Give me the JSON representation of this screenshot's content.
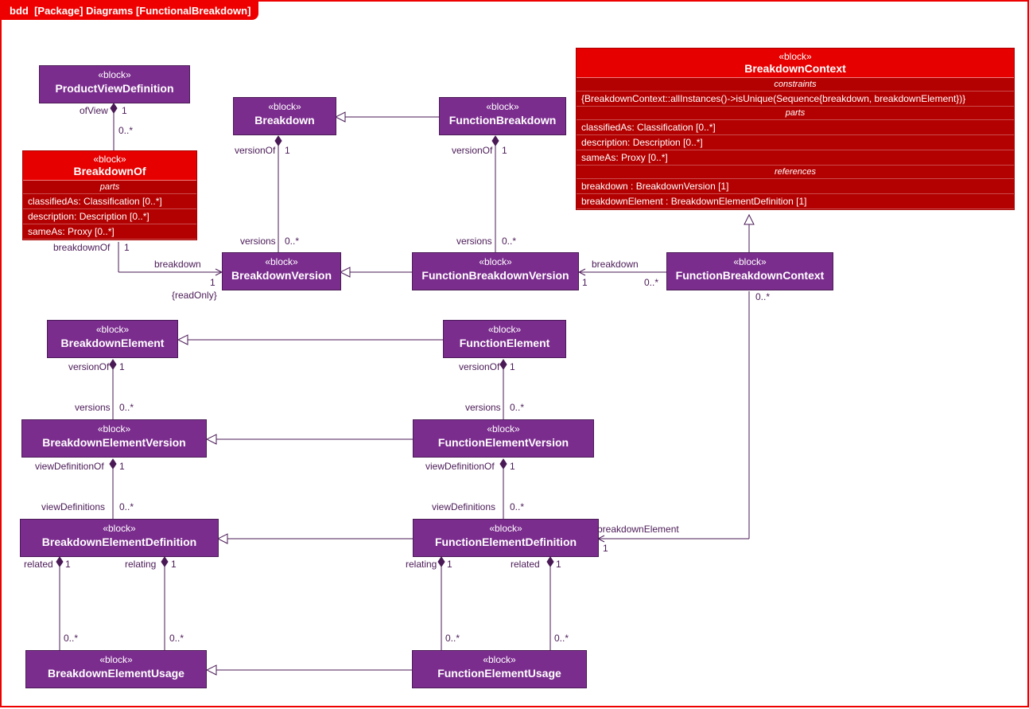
{
  "frame": {
    "prefix": "bdd",
    "title": "[Package] Diagrams [FunctionalBreakdown]"
  },
  "stereo": "«block»",
  "blocks": {
    "pvd": "ProductViewDefinition",
    "bof": "BreakdownOf",
    "bd": "Breakdown",
    "fbd": "FunctionBreakdown",
    "bdc": "BreakdownContext",
    "bv": "BreakdownVersion",
    "fbv": "FunctionBreakdownVersion",
    "fbc": "FunctionBreakdownContext",
    "be": "BreakdownElement",
    "fe": "FunctionElement",
    "bev": "BreakdownElementVersion",
    "fev": "FunctionElementVersion",
    "bed": "BreakdownElementDefinition",
    "fed": "FunctionElementDefinition",
    "beu": "BreakdownElementUsage",
    "feu": "FunctionElementUsage"
  },
  "bof_section_parts_title": "parts",
  "bof_parts": [
    "classifiedAs: Classification [0..*]",
    "description: Description [0..*]",
    "sameAs: Proxy [0..*]"
  ],
  "bdc_constraints_title": "constraints",
  "bdc_constraints": "{BreakdownContext::allInstances()->isUnique(Sequence{breakdown, breakdownElement})}",
  "bdc_parts_title": "parts",
  "bdc_parts": [
    "classifiedAs: Classification [0..*]",
    "description: Description [0..*]",
    "sameAs: Proxy [0..*]"
  ],
  "bdc_refs_title": "references",
  "bdc_refs": [
    "breakdown : BreakdownVersion [1]",
    "breakdownElement : BreakdownElementDefinition [1]"
  ],
  "labels": {
    "ofView": "ofView",
    "one": "1",
    "zeroStar": "0..*",
    "versionOf": "versionOf",
    "versions": "versions",
    "breakdownOf": "breakdownOf",
    "breakdown": "breakdown",
    "readOnly": "{readOnly}",
    "viewDefinitionOf": "viewDefinitionOf",
    "viewDefinitions": "viewDefinitions",
    "related": "related",
    "relating": "relating",
    "breakdownElement": "breakdownElement"
  }
}
